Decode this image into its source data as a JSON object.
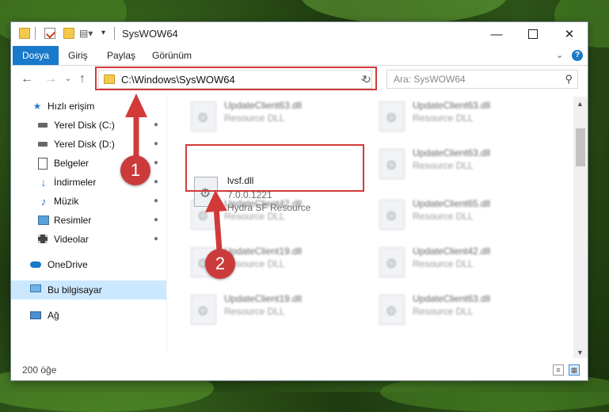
{
  "window": {
    "title": "SysWOW64"
  },
  "ribbon": {
    "tabs": [
      "Dosya",
      "Giriş",
      "Paylaş",
      "Görünüm"
    ]
  },
  "address": {
    "path": "C:\\Windows\\SysWOW64"
  },
  "search": {
    "placeholder": "Ara: SysWOW64"
  },
  "sidebar": {
    "quick_access": "Hızlı erişim",
    "items": [
      {
        "label": "Yerel Disk (C:)",
        "icon": "drive-icon",
        "pinned": true
      },
      {
        "label": "Yerel Disk (D:)",
        "icon": "drive-icon",
        "pinned": true
      },
      {
        "label": "Belgeler",
        "icon": "documents-icon",
        "pinned": true
      },
      {
        "label": "İndirmeler",
        "icon": "download-icon",
        "pinned": true
      },
      {
        "label": "Müzik",
        "icon": "music-icon",
        "pinned": true
      },
      {
        "label": "Resimler",
        "icon": "pictures-icon",
        "pinned": true
      },
      {
        "label": "Videolar",
        "icon": "video-icon",
        "pinned": true
      }
    ],
    "onedrive": "OneDrive",
    "this_pc": "Bu bilgisayar",
    "network": "Ağ"
  },
  "files": {
    "col1": [
      {
        "name": "UpdateClient63.dll",
        "type": "Resource DLL"
      },
      {
        "name": "UpdateClient42.dll",
        "type": "Resource DLL"
      },
      {
        "name": "UpdateClient19.dll",
        "type": "Resource DLL"
      },
      {
        "name": "UpdateClient19.dll",
        "type": "Resource DLL"
      }
    ],
    "col2": [
      {
        "name": "UpdateClient63.dll",
        "type": "Resource DLL"
      },
      {
        "name": "UpdateClient63.dll",
        "type": "Resource DLL"
      },
      {
        "name": "UpdateClient65.dll",
        "type": "Resource DLL"
      },
      {
        "name": "UpdateClient42.dll",
        "type": "Resource DLL"
      },
      {
        "name": "UpdateClient63.dll",
        "type": "Resource DLL"
      }
    ],
    "highlighted": {
      "name": "lvsf.dll",
      "version": "7.0.0.1221",
      "description": "Hydra SF Resource"
    }
  },
  "status": {
    "count": "200 öğe"
  },
  "callouts": [
    "1",
    "2"
  ],
  "colors": {
    "accent": "#1979ca",
    "highlight": "#d23a3a",
    "selected": "#cce8ff"
  }
}
